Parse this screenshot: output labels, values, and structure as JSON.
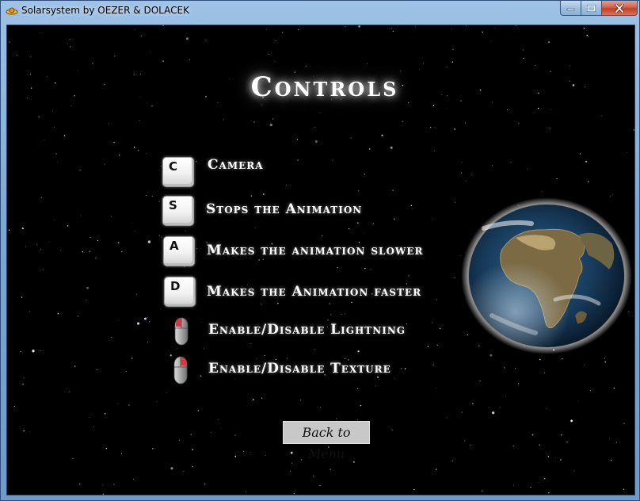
{
  "window": {
    "title": "Solarsystem by OEZER & DOLACEK"
  },
  "titlebar_buttons": {
    "minimize_icon": "minimize-icon",
    "maximize_icon": "maximize-icon",
    "close_icon": "close-icon"
  },
  "page": {
    "heading": "Controls"
  },
  "controls": [
    {
      "key": "C",
      "icon": "key-c-icon",
      "label": "Camera"
    },
    {
      "key": "S",
      "icon": "key-s-icon",
      "label": "Stops the Animation"
    },
    {
      "key": "A",
      "icon": "key-a-icon",
      "label": "Makes the animation slower"
    },
    {
      "key": "D",
      "icon": "key-d-icon",
      "label": "Makes the Animation faster"
    },
    {
      "key": "",
      "icon": "mouse-left-button-icon",
      "label": "Enable/Disable Lightning"
    },
    {
      "key": "",
      "icon": "mouse-right-button-icon",
      "label": "Enable/Disable Texture"
    }
  ],
  "back_button": {
    "label": "Back to Menu"
  },
  "colors": {
    "background": "#000000",
    "text": "#ffffff",
    "titlebar": "#7aa9d6",
    "close_button": "#c0402a",
    "mouse_button_highlight": "#d9363e"
  },
  "decorations": {
    "background_image": "starfield",
    "planet_image": "earth-globe-icon"
  }
}
